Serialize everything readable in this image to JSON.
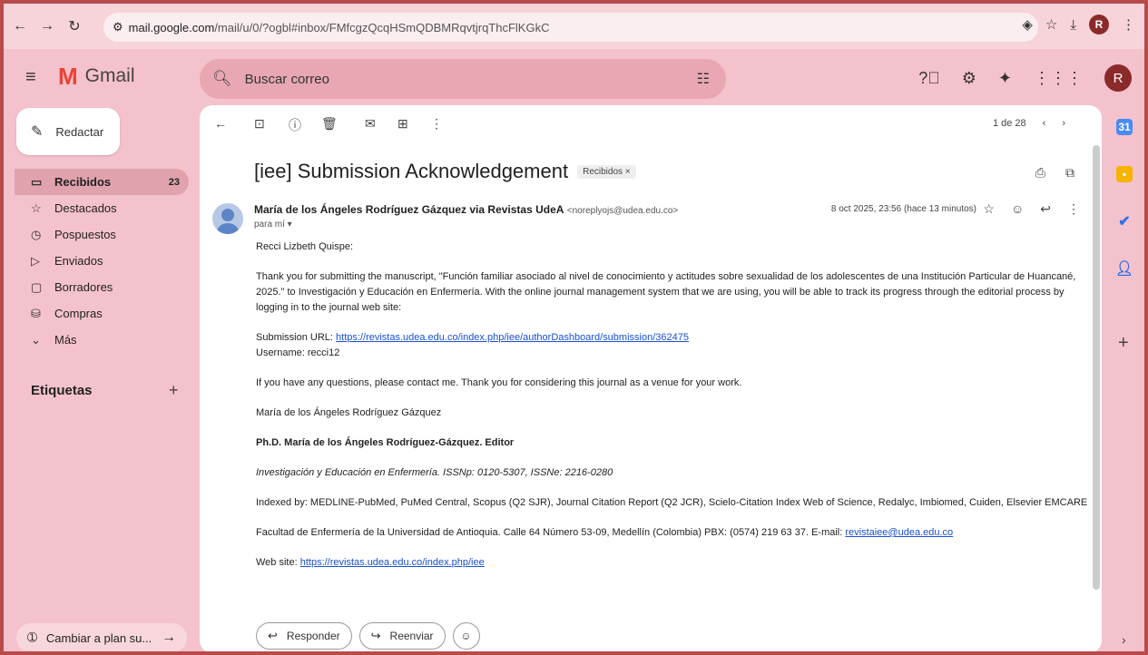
{
  "browser": {
    "url_site": "mail.google.com",
    "url_rest": "/mail/u/0/?ogbl#inbox/FMfcgzQcqHSmQDBMRqvtjrqThcFlKGkC",
    "avatar_letter": "R"
  },
  "header": {
    "app_name": "Gmail",
    "search_placeholder": "Buscar correo",
    "avatar_letter": "R"
  },
  "sidebar": {
    "compose_label": "Redactar",
    "items": [
      {
        "label": "Recibidos",
        "count": "23",
        "icon": "inbox-icon"
      },
      {
        "label": "Destacados",
        "count": "",
        "icon": "star-icon"
      },
      {
        "label": "Pospuestos",
        "count": "",
        "icon": "clock-icon"
      },
      {
        "label": "Enviados",
        "count": "",
        "icon": "send-icon"
      },
      {
        "label": "Borradores",
        "count": "",
        "icon": "draft-icon"
      },
      {
        "label": "Compras",
        "count": "",
        "icon": "shopping-icon"
      },
      {
        "label": "Más",
        "count": "",
        "icon": "chevron-down-icon"
      }
    ],
    "labels_title": "Etiquetas",
    "upgrade_label": "Cambiar a plan su..."
  },
  "toolbar": {
    "pager": "1 de 28"
  },
  "message": {
    "subject": "[iee] Submission Acknowledgement",
    "chip": "Recibidos ×",
    "sender_name": "María de los Ángeles Rodríguez Gázquez via Revistas UdeA",
    "sender_email": "<noreplyojs@udea.edu.co>",
    "to": "para mí ▾",
    "date": "8 oct 2025, 23:56 (hace 13 minutos)",
    "greeting": "Recci Lizbeth Quispe:",
    "para1": "Thank you for submitting the manuscript, \"Función familiar asociado al nivel de conocimiento y actitudes sobre sexualidad de los adolescentes de una Institución Particular de Huancané, 2025.\" to Investigación y Educación en Enfermería. With the online journal management system that we are using, you will be able to track its progress through the editorial process by logging in to the journal web site:",
    "submission_prefix": "Submission URL: ",
    "submission_url": "https://revistas.udea.edu.co/index.php/iee/authorDashboard/submission/362475",
    "username": "Username: recci12",
    "para2": "If you have any questions, please contact me. Thank you for considering this journal as a venue for your work.",
    "signature_name": "María de los Ángeles Rodríguez Gázquez",
    "editor_line": "Ph.D. María de los Ángeles Rodríguez-Gázquez. Editor",
    "journal_line": "Investigación y Educación en Enfermería.  ISSNp: 0120-5307, ISSNe: 2216-0280",
    "indexed_line": "Indexed by: MEDLINE-PubMed, PuMed Central, Scopus (Q2 SJR), Journal Citation Report (Q2 JCR), Scielo-Citation Index Web of Science, Redalyc, Imbiomed, Cuiden, Elsevier EMCARE",
    "address_line": "Facultad de Enfermería de la Universidad de Antioquia. Calle 64 Número 53-09, Medellín (Colombia) PBX: (0574) 219 63 37. E-mail: ",
    "address_email": "revistaiee@udea.edu.co",
    "website_prefix": "Web site: ",
    "website_url": "https://revistas.udea.edu.co/index.php/iee"
  },
  "actions": {
    "reply_label": "Responder",
    "forward_label": "Reenviar"
  }
}
